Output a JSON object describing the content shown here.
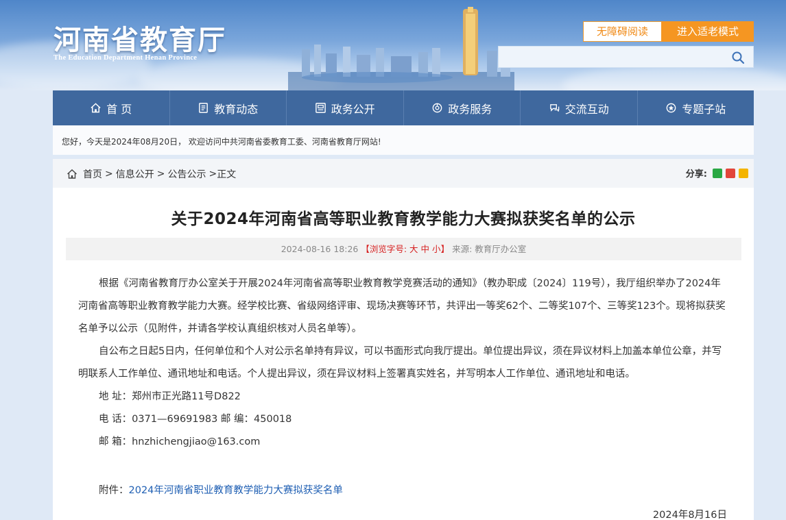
{
  "header": {
    "logo_cn": "河南省教育厅",
    "logo_en": "The Education Department Henan Province",
    "accessibility_label": "无障碍阅读",
    "elder_mode_label": "进入适老模式",
    "search_placeholder": ""
  },
  "nav": {
    "items": [
      {
        "label": "首 页",
        "icon": "home-icon"
      },
      {
        "label": "教育动态",
        "icon": "news-icon"
      },
      {
        "label": "政务公开",
        "icon": "document-icon"
      },
      {
        "label": "政务服务",
        "icon": "service-icon"
      },
      {
        "label": "交流互动",
        "icon": "interact-icon"
      },
      {
        "label": "专题子站",
        "icon": "topic-icon"
      }
    ]
  },
  "welcome_text": "您好，今天是2024年08月20日，  欢迎访问中共河南省委教育工委、河南省教育厅网站!",
  "breadcrumb": {
    "home": "首页",
    "level1": "信息公开",
    "level2": "公告公示",
    "current": "正文"
  },
  "share_label": "分享:",
  "article": {
    "title": "关于2024年河南省高等职业教育教学能力大赛拟获奖名单的公示",
    "meta": {
      "datetime": "2024-08-16 18:26",
      "font_label_open": "【浏览字号: ",
      "font_large": "大",
      "font_medium": "中",
      "font_small": "小",
      "font_label_close": "】",
      "source": "来源: 教育厅办公室"
    },
    "para1": "根据《河南省教育厅办公室关于开展2024年河南省高等职业教育教学竞赛活动的通知》（教办职成〔2024〕119号），我厅组织举办了2024年河南省高等职业教育教学能力大赛。经学校比赛、省级网络评审、现场决赛等环节，共评出一等奖62个、二等奖107个、三等奖123个。现将拟获奖名单予以公示（见附件，并请各学校认真组织核对人员名单等）。",
    "para2": "自公布之日起5日内，任何单位和个人对公示名单持有异议，可以书面形式向我厅提出。单位提出异议，须在异议材料上加盖本单位公章，并写明联系人工作单位、通讯地址和电话。个人提出异议，须在异议材料上签署真实姓名，并写明本人工作单位、通讯地址和电话。",
    "address": "地 址：郑州市正光路11号D822",
    "phone": "电 话：0371—69691983 邮 编：450018",
    "email": "邮 箱：hnzhichengjiao@163.com",
    "attachment_label": "附件：",
    "attachment_link": "2024年河南省职业教育教学能力大赛拟获奖名单",
    "sign_date": "2024年8月16日"
  },
  "colors": {
    "nav_bg": "#3f689e",
    "accent_orange": "#f59622",
    "link_blue": "#1f5fb3",
    "meta_red": "#d61f1f"
  }
}
